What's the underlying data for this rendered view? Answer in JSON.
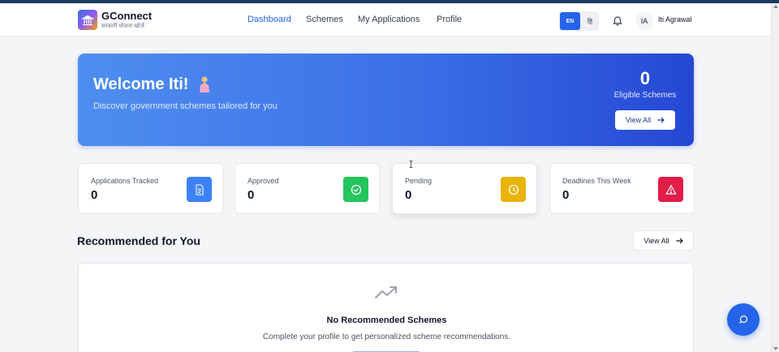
{
  "app": {
    "brand_name": "GConnect",
    "brand_tagline": "सरकारी योजना खोजें",
    "logo_icon": "government-building-icon"
  },
  "nav": {
    "links": [
      {
        "label": "Dashboard",
        "active": true
      },
      {
        "label": "Schemes",
        "active": false
      },
      {
        "label": "My Applications",
        "active": false
      },
      {
        "label": "Profile",
        "active": false
      }
    ],
    "lang_en": "EN",
    "lang_hi": "हि",
    "avatar_initials": "IA",
    "user_name": "Iti Agrawal"
  },
  "hero": {
    "title": "Welcome Iti!",
    "subtitle": "Discover government schemes tailored for you",
    "count": "0",
    "count_label": "Eligible Schemes",
    "button_label": "View All",
    "gradient_start": "#4f8ef0",
    "gradient_end": "#2548d4"
  },
  "stats": [
    {
      "label": "Applications Tracked",
      "value": "0",
      "icon": "document-icon",
      "color": "#3b82f6"
    },
    {
      "label": "Approved",
      "value": "0",
      "icon": "check-circle-icon",
      "color": "#22c55e"
    },
    {
      "label": "Pending",
      "value": "0",
      "icon": "clock-icon",
      "color": "#eab308"
    },
    {
      "label": "Deadlines This Week",
      "value": "0",
      "icon": "warning-triangle-icon",
      "color": "#e11d48"
    }
  ],
  "recommended": {
    "title": "Recommended for You",
    "button_label": "View All",
    "empty_title": "No Recommended Schemes",
    "empty_subtitle": "Complete your profile to get personalized scheme recommendations."
  },
  "colors": {
    "accent": "#2563eb",
    "background": "#f4f5f7"
  }
}
